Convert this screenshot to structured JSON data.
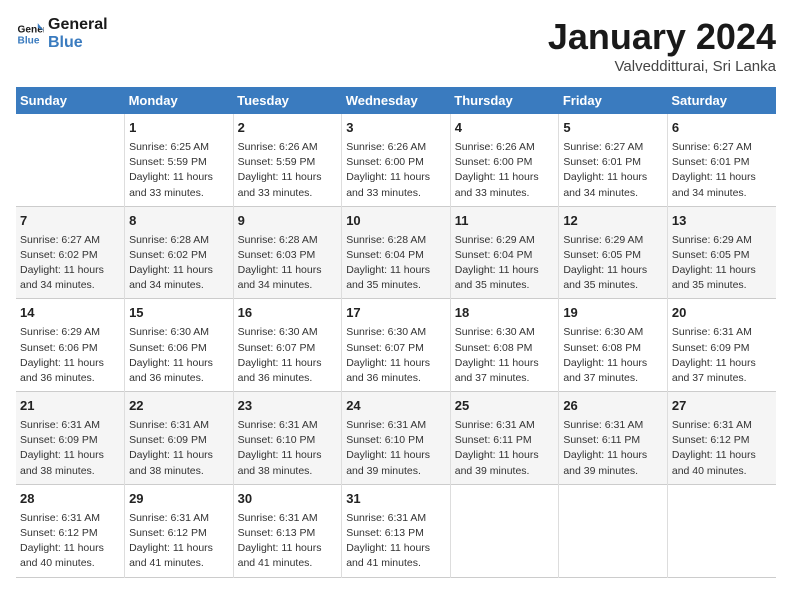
{
  "header": {
    "logo_line1": "General",
    "logo_line2": "Blue",
    "month": "January 2024",
    "location": "Valvedditturai, Sri Lanka"
  },
  "weekdays": [
    "Sunday",
    "Monday",
    "Tuesday",
    "Wednesday",
    "Thursday",
    "Friday",
    "Saturday"
  ],
  "weeks": [
    [
      {
        "day": "",
        "detail": ""
      },
      {
        "day": "1",
        "detail": "Sunrise: 6:25 AM\nSunset: 5:59 PM\nDaylight: 11 hours\nand 33 minutes."
      },
      {
        "day": "2",
        "detail": "Sunrise: 6:26 AM\nSunset: 5:59 PM\nDaylight: 11 hours\nand 33 minutes."
      },
      {
        "day": "3",
        "detail": "Sunrise: 6:26 AM\nSunset: 6:00 PM\nDaylight: 11 hours\nand 33 minutes."
      },
      {
        "day": "4",
        "detail": "Sunrise: 6:26 AM\nSunset: 6:00 PM\nDaylight: 11 hours\nand 33 minutes."
      },
      {
        "day": "5",
        "detail": "Sunrise: 6:27 AM\nSunset: 6:01 PM\nDaylight: 11 hours\nand 34 minutes."
      },
      {
        "day": "6",
        "detail": "Sunrise: 6:27 AM\nSunset: 6:01 PM\nDaylight: 11 hours\nand 34 minutes."
      }
    ],
    [
      {
        "day": "7",
        "detail": "Sunrise: 6:27 AM\nSunset: 6:02 PM\nDaylight: 11 hours\nand 34 minutes."
      },
      {
        "day": "8",
        "detail": "Sunrise: 6:28 AM\nSunset: 6:02 PM\nDaylight: 11 hours\nand 34 minutes."
      },
      {
        "day": "9",
        "detail": "Sunrise: 6:28 AM\nSunset: 6:03 PM\nDaylight: 11 hours\nand 34 minutes."
      },
      {
        "day": "10",
        "detail": "Sunrise: 6:28 AM\nSunset: 6:04 PM\nDaylight: 11 hours\nand 35 minutes."
      },
      {
        "day": "11",
        "detail": "Sunrise: 6:29 AM\nSunset: 6:04 PM\nDaylight: 11 hours\nand 35 minutes."
      },
      {
        "day": "12",
        "detail": "Sunrise: 6:29 AM\nSunset: 6:05 PM\nDaylight: 11 hours\nand 35 minutes."
      },
      {
        "day": "13",
        "detail": "Sunrise: 6:29 AM\nSunset: 6:05 PM\nDaylight: 11 hours\nand 35 minutes."
      }
    ],
    [
      {
        "day": "14",
        "detail": "Sunrise: 6:29 AM\nSunset: 6:06 PM\nDaylight: 11 hours\nand 36 minutes."
      },
      {
        "day": "15",
        "detail": "Sunrise: 6:30 AM\nSunset: 6:06 PM\nDaylight: 11 hours\nand 36 minutes."
      },
      {
        "day": "16",
        "detail": "Sunrise: 6:30 AM\nSunset: 6:07 PM\nDaylight: 11 hours\nand 36 minutes."
      },
      {
        "day": "17",
        "detail": "Sunrise: 6:30 AM\nSunset: 6:07 PM\nDaylight: 11 hours\nand 36 minutes."
      },
      {
        "day": "18",
        "detail": "Sunrise: 6:30 AM\nSunset: 6:08 PM\nDaylight: 11 hours\nand 37 minutes."
      },
      {
        "day": "19",
        "detail": "Sunrise: 6:30 AM\nSunset: 6:08 PM\nDaylight: 11 hours\nand 37 minutes."
      },
      {
        "day": "20",
        "detail": "Sunrise: 6:31 AM\nSunset: 6:09 PM\nDaylight: 11 hours\nand 37 minutes."
      }
    ],
    [
      {
        "day": "21",
        "detail": "Sunrise: 6:31 AM\nSunset: 6:09 PM\nDaylight: 11 hours\nand 38 minutes."
      },
      {
        "day": "22",
        "detail": "Sunrise: 6:31 AM\nSunset: 6:09 PM\nDaylight: 11 hours\nand 38 minutes."
      },
      {
        "day": "23",
        "detail": "Sunrise: 6:31 AM\nSunset: 6:10 PM\nDaylight: 11 hours\nand 38 minutes."
      },
      {
        "day": "24",
        "detail": "Sunrise: 6:31 AM\nSunset: 6:10 PM\nDaylight: 11 hours\nand 39 minutes."
      },
      {
        "day": "25",
        "detail": "Sunrise: 6:31 AM\nSunset: 6:11 PM\nDaylight: 11 hours\nand 39 minutes."
      },
      {
        "day": "26",
        "detail": "Sunrise: 6:31 AM\nSunset: 6:11 PM\nDaylight: 11 hours\nand 39 minutes."
      },
      {
        "day": "27",
        "detail": "Sunrise: 6:31 AM\nSunset: 6:12 PM\nDaylight: 11 hours\nand 40 minutes."
      }
    ],
    [
      {
        "day": "28",
        "detail": "Sunrise: 6:31 AM\nSunset: 6:12 PM\nDaylight: 11 hours\nand 40 minutes."
      },
      {
        "day": "29",
        "detail": "Sunrise: 6:31 AM\nSunset: 6:12 PM\nDaylight: 11 hours\nand 41 minutes."
      },
      {
        "day": "30",
        "detail": "Sunrise: 6:31 AM\nSunset: 6:13 PM\nDaylight: 11 hours\nand 41 minutes."
      },
      {
        "day": "31",
        "detail": "Sunrise: 6:31 AM\nSunset: 6:13 PM\nDaylight: 11 hours\nand 41 minutes."
      },
      {
        "day": "",
        "detail": ""
      },
      {
        "day": "",
        "detail": ""
      },
      {
        "day": "",
        "detail": ""
      }
    ]
  ]
}
